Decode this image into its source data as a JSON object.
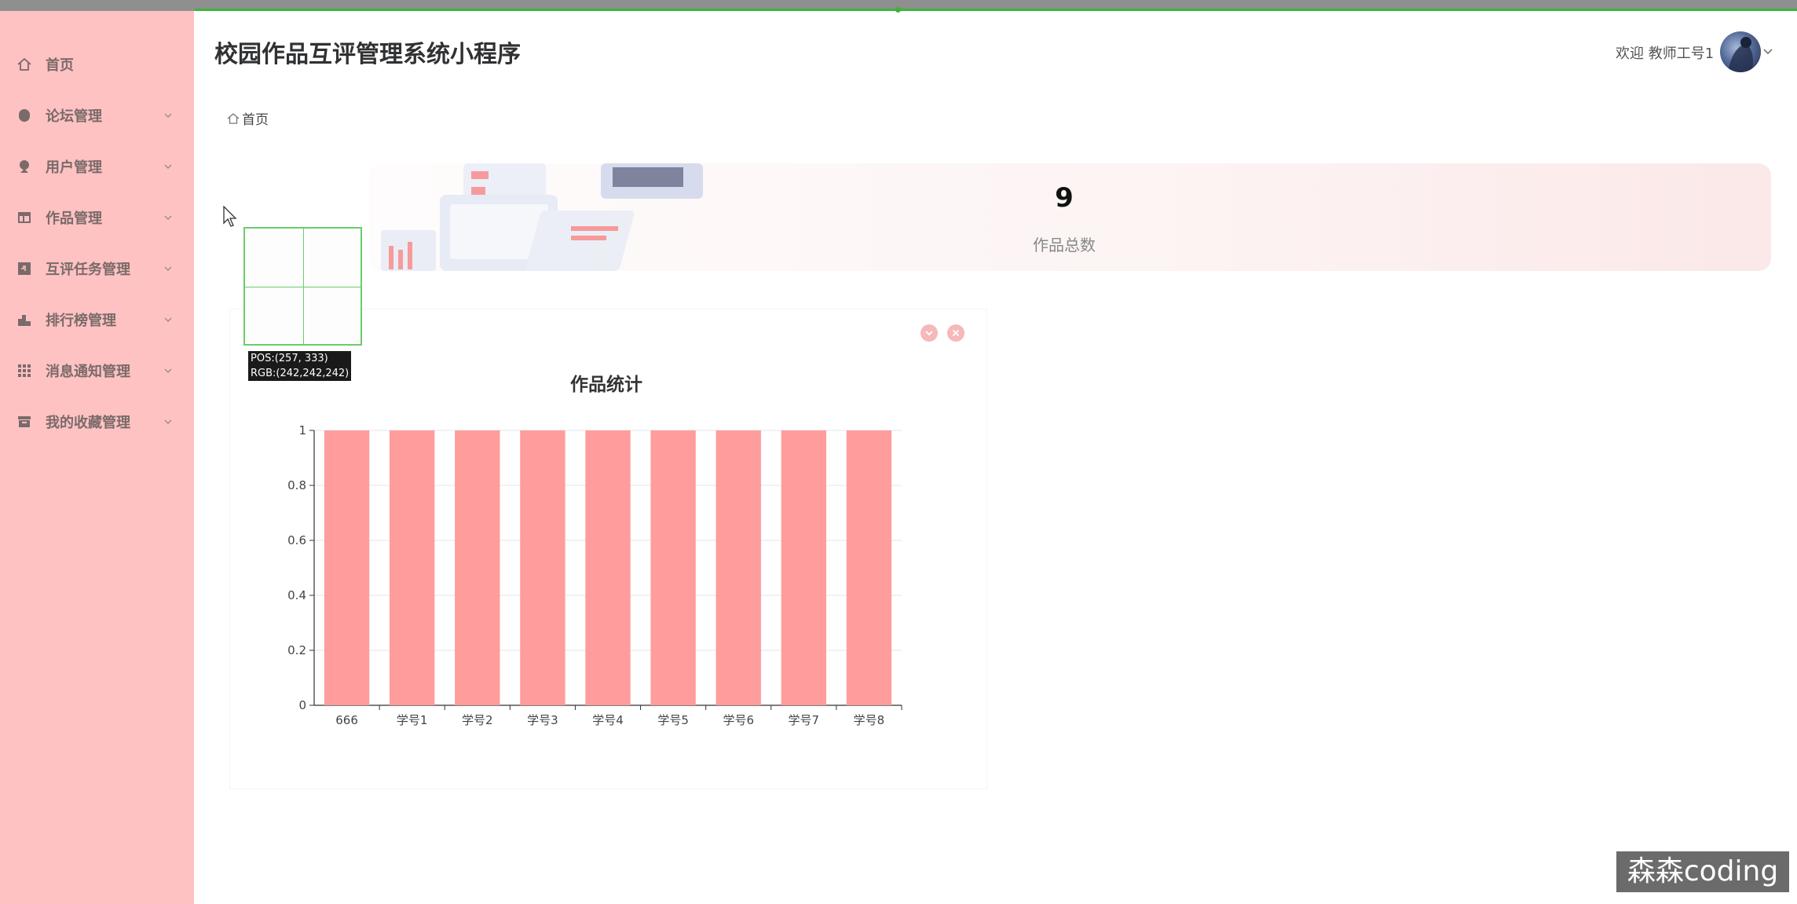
{
  "header": {
    "app_title": "校园作品互评管理系统小程序",
    "welcome": "欢迎 教师工号1"
  },
  "sidebar": {
    "items": [
      {
        "label": "首页",
        "icon": "home-icon"
      },
      {
        "label": "论坛管理",
        "icon": "forum-icon"
      },
      {
        "label": "用户管理",
        "icon": "user-icon"
      },
      {
        "label": "作品管理",
        "icon": "works-icon"
      },
      {
        "label": "互评任务管理",
        "icon": "task-icon"
      },
      {
        "label": "排行榜管理",
        "icon": "ranking-icon"
      },
      {
        "label": "消息通知管理",
        "icon": "grid-icon"
      },
      {
        "label": "我的收藏管理",
        "icon": "favorite-icon"
      }
    ]
  },
  "breadcrumb": {
    "home": "首页"
  },
  "stats": {
    "total_works_value": "9",
    "total_works_label": "作品总数"
  },
  "colors": {
    "sidebar_bg": "#ffc2c2",
    "bar_color": "#ff9c9c",
    "accent": "#f6b8b8"
  },
  "picker": {
    "pos": "POS:(257, 333)",
    "rgb": "RGB:(242,242,242)"
  },
  "watermark": "森森coding",
  "chart_data": {
    "type": "bar",
    "title": "作品统计",
    "categories": [
      "666",
      "学号1",
      "学号2",
      "学号3",
      "学号4",
      "学号5",
      "学号6",
      "学号7",
      "学号8"
    ],
    "values": [
      1,
      1,
      1,
      1,
      1,
      1,
      1,
      1,
      1
    ],
    "yticks": [
      "0",
      "0.2",
      "0.4",
      "0.6",
      "0.8",
      "1"
    ],
    "ylim": [
      0,
      1
    ],
    "grid": true
  }
}
